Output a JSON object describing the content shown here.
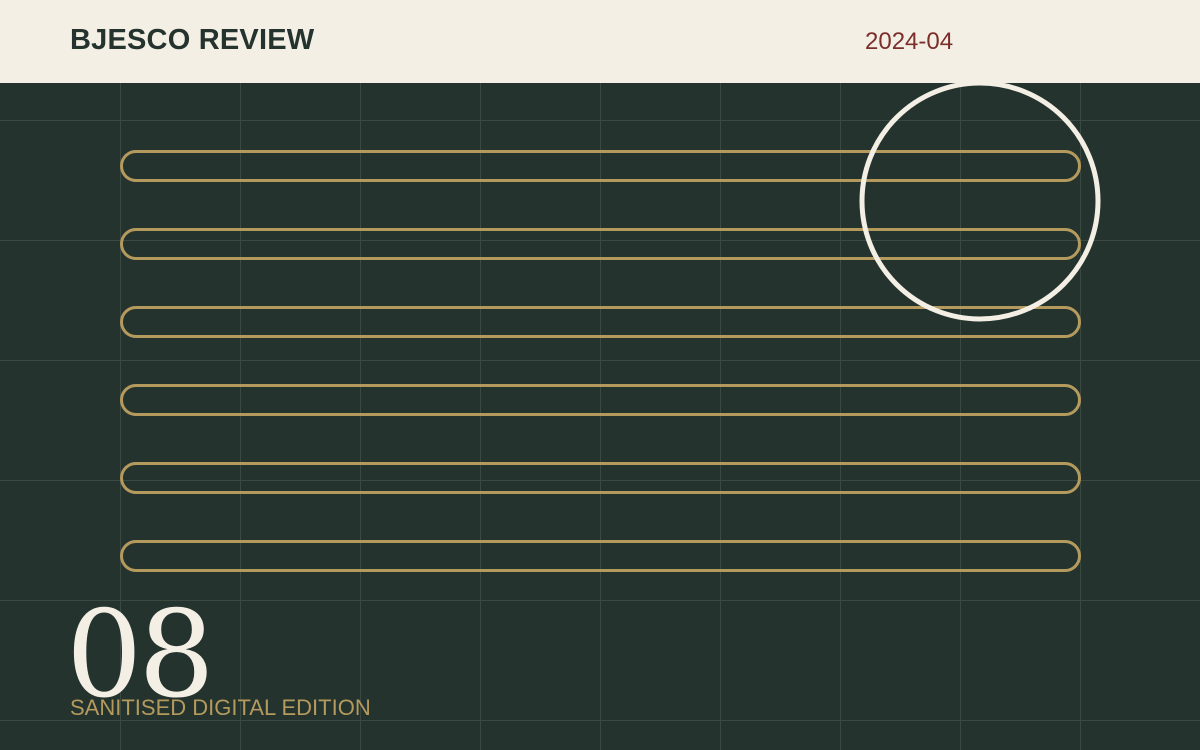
{
  "header": {
    "brand": "BJESCO REVIEW",
    "date": "2024-04"
  },
  "cover": {
    "issue_number": "08",
    "edition": "SANITISED DIGITAL EDITION"
  },
  "colors": {
    "background": "#24332e",
    "header_background": "#f4efe5",
    "gold": "#b59a5e",
    "cream": "#f4efe5",
    "date_red": "#7b2e2a",
    "grid": "#3a4a43"
  }
}
